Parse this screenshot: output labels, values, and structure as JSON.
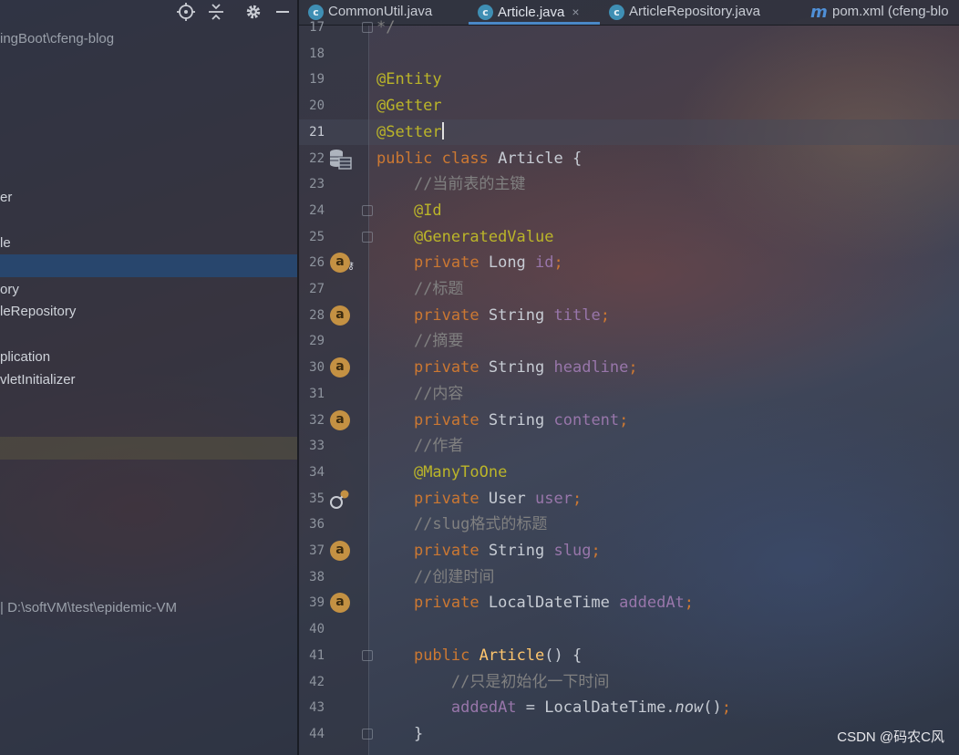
{
  "project_panel": {
    "toolbar_icons": [
      "locate-icon",
      "collapse-icon",
      "gear-icon",
      "hide-icon"
    ],
    "tree_rows": [
      {
        "text": "ingBoot\\cfeng-blog",
        "kind": "path"
      },
      {
        "text": "er",
        "kind": "node"
      },
      {
        "text": "le",
        "kind": "node"
      },
      {
        "text": "",
        "kind": "selected"
      },
      {
        "text": "ory",
        "kind": "node"
      },
      {
        "text": "leRepository",
        "kind": "node"
      },
      {
        "text": "plication",
        "kind": "node"
      },
      {
        "text": "vletInitializer",
        "kind": "node"
      },
      {
        "text": "",
        "kind": "highlight"
      },
      {
        "text": "|  D:\\softVM\\test\\epidemic-VM",
        "kind": "path"
      }
    ]
  },
  "tabs": [
    {
      "label": "CommonUtil.java",
      "icon": "class-icon",
      "icon_glyph": "c",
      "active": false
    },
    {
      "label": "Article.java",
      "icon": "class-icon",
      "icon_glyph": "c",
      "active": true
    },
    {
      "label": "ArticleRepository.java",
      "icon": "class-icon",
      "icon_glyph": "c",
      "active": false
    },
    {
      "label": "pom.xml (cfeng-blo",
      "icon": "maven-icon",
      "icon_glyph": "m",
      "active": false
    }
  ],
  "tab_close_glyph": "×",
  "editor": {
    "current_line": "21",
    "lines": [
      {
        "no": "17",
        "code": "*/"
      },
      {
        "no": "18",
        "code": ""
      },
      {
        "no": "19",
        "code": "@Entity"
      },
      {
        "no": "20",
        "code": "@Getter"
      },
      {
        "no": "21",
        "code": "@Setter"
      },
      {
        "no": "22",
        "code": "public class Article {"
      },
      {
        "no": "23",
        "code": "    //当前表的主键"
      },
      {
        "no": "24",
        "code": "    @Id"
      },
      {
        "no": "25",
        "code": "    @GeneratedValue"
      },
      {
        "no": "26",
        "code": "    private Long id;"
      },
      {
        "no": "27",
        "code": "    //标题"
      },
      {
        "no": "28",
        "code": "    private String title;"
      },
      {
        "no": "29",
        "code": "    //摘要"
      },
      {
        "no": "30",
        "code": "    private String headline;"
      },
      {
        "no": "31",
        "code": "    //内容"
      },
      {
        "no": "32",
        "code": "    private String content;"
      },
      {
        "no": "33",
        "code": "    //作者"
      },
      {
        "no": "34",
        "code": "    @ManyToOne"
      },
      {
        "no": "35",
        "code": "    private User user;"
      },
      {
        "no": "36",
        "code": "    //slug格式的标题"
      },
      {
        "no": "37",
        "code": "    private String slug;"
      },
      {
        "no": "38",
        "code": "    //创建时间"
      },
      {
        "no": "39",
        "code": "    private LocalDateTime addedAt;"
      },
      {
        "no": "40",
        "code": ""
      },
      {
        "no": "41",
        "code": "    public Article() {"
      },
      {
        "no": "42",
        "code": "        //只是初始化一下时间"
      },
      {
        "no": "43",
        "code": "        addedAt = LocalDateTime.now();"
      },
      {
        "no": "44",
        "code": "    }"
      }
    ],
    "gutter_icons": [
      {
        "line": "22",
        "icon": "database-table-icon"
      },
      {
        "line": "26",
        "icon": "attribute-key-icon",
        "glyph": "a"
      },
      {
        "line": "28",
        "icon": "attribute-icon",
        "glyph": "a"
      },
      {
        "line": "30",
        "icon": "attribute-icon",
        "glyph": "a"
      },
      {
        "line": "32",
        "icon": "attribute-icon",
        "glyph": "a"
      },
      {
        "line": "35",
        "icon": "relation-icon"
      },
      {
        "line": "37",
        "icon": "attribute-icon",
        "glyph": "a"
      },
      {
        "line": "39",
        "icon": "attribute-icon",
        "glyph": "a"
      }
    ]
  },
  "watermark": "CSDN @码农C风",
  "colors": {
    "keyword": "#cc7832",
    "annotation": "#bbb529",
    "field": "#9876aa",
    "comment": "#808080",
    "method": "#ffc66d",
    "active_tab_underline": "#4a88c7",
    "selection": "#264a76"
  }
}
